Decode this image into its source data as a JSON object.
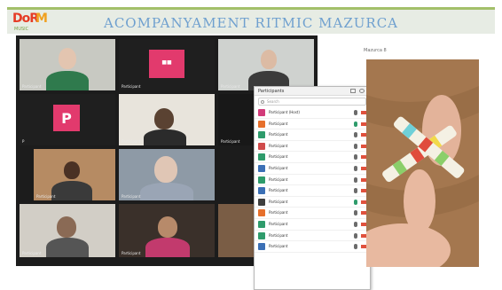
{
  "slide": {
    "logo_text_a": "DoR",
    "logo_text_b": "M",
    "logo_subtext": "MUSIC",
    "title": "ACOMPANYAMENT RITMIC MAZURCA",
    "side_label": "Mazurca 8"
  },
  "video_grid": {
    "tiles": [
      {
        "caption": "Participant"
      },
      {
        "caption": "Participant"
      },
      {
        "caption": "Participant"
      },
      {
        "caption": "P",
        "initial": "P"
      },
      {
        "caption": "Participant"
      },
      {
        "caption": "Participant"
      },
      {
        "caption": "Participant"
      },
      {
        "caption": "Participant"
      },
      {
        "caption": "Participant"
      },
      {
        "caption": "Participant"
      }
    ]
  },
  "participants_panel": {
    "title": "Participants",
    "search_placeholder": "Search",
    "rows": [
      {
        "name": "Participant (Host)",
        "avatar_color": "#d23b7a"
      },
      {
        "name": "Participant",
        "avatar_color": "#e66f2b"
      },
      {
        "name": "Participant",
        "avatar_color": "#2e9b6b"
      },
      {
        "name": "Participant",
        "avatar_color": "#d04b4b"
      },
      {
        "name": "Participant",
        "avatar_color": "#2e9b6b"
      },
      {
        "name": "Participant",
        "avatar_color": "#3b6fb5"
      },
      {
        "name": "Participant",
        "avatar_color": "#2e9b6b"
      },
      {
        "name": "Participant",
        "avatar_color": "#3b6fb5"
      },
      {
        "name": "Participant",
        "avatar_color": "#3e3e3e"
      },
      {
        "name": "Participant",
        "avatar_color": "#e66f2b"
      },
      {
        "name": "Participant",
        "avatar_color": "#2e9b6b"
      },
      {
        "name": "Participant",
        "avatar_color": "#2e9b6b"
      },
      {
        "name": "Participant",
        "avatar_color": "#3b6fb5"
      }
    ]
  },
  "colors": {
    "title_blue": "#6fa0cf",
    "accent_green": "#a3c06a",
    "zoom_pink": "#e23a6d"
  }
}
